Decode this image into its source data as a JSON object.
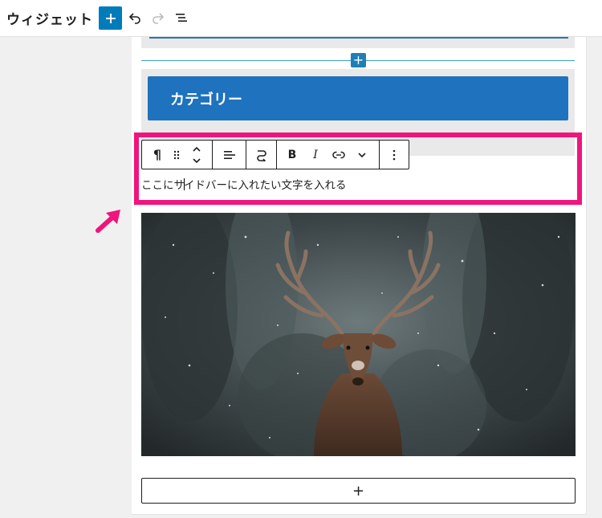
{
  "header": {
    "title": "ウィジェット",
    "icons": [
      "plus-icon",
      "undo-icon",
      "redo-icon",
      "list-view-icon"
    ]
  },
  "blocks": {
    "category_title": "カテゴリー",
    "paragraph_before_caret": "ここにサ",
    "paragraph_after_caret": "イドバーに入れたい文字を入れる"
  },
  "toolbar": {
    "paragraph_symbol": "¶",
    "bold": "B",
    "italic": "I",
    "buttons": [
      "paragraph-icon",
      "drag-handle-icon",
      "move-updown-icon",
      "align-left-icon",
      "transform-icon",
      "bold-icon",
      "italic-icon",
      "link-icon",
      "chevron-down-icon",
      "more-options-icon"
    ]
  },
  "colors": {
    "accent": "#007cba",
    "category_banner": "#1e72be",
    "highlight": "#f0147c"
  },
  "insert_plus": "+",
  "appender_plus": "+"
}
